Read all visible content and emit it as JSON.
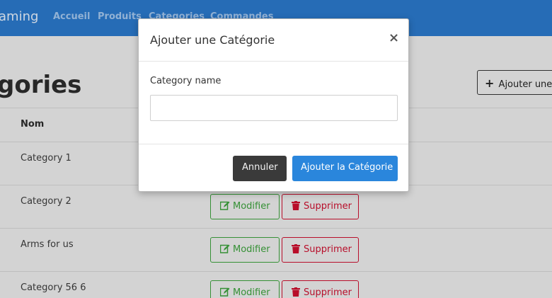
{
  "navbar": {
    "brand": "aming",
    "links": [
      "Accueil",
      "Produits",
      "Categories",
      "Commandes"
    ]
  },
  "page": {
    "title": "gories",
    "add_button": "Ajouter une C"
  },
  "table": {
    "column_name": "Nom",
    "rows": [
      {
        "name": "Category 1"
      },
      {
        "name": "Category 2"
      },
      {
        "name": "Arms for us"
      },
      {
        "name": "Category 56 6"
      }
    ],
    "edit_label": "Modifier",
    "delete_label": "Supprimer"
  },
  "modal": {
    "title": "Ajouter une Catégorie",
    "close_symbol": "×",
    "field_label": "Category name",
    "field_value": "",
    "cancel_label": "Annuler",
    "submit_label": "Ajouter la Catégorie"
  },
  "colors": {
    "navbar": "#2a76c6",
    "edit": "#3a9d3a",
    "delete": "#c8102e",
    "primary": "#2a86dc",
    "secondary": "#3a3a3a"
  },
  "icons": {
    "add": "plus-icon",
    "edit": "edit-icon",
    "delete": "trash-icon",
    "close": "close-icon"
  }
}
